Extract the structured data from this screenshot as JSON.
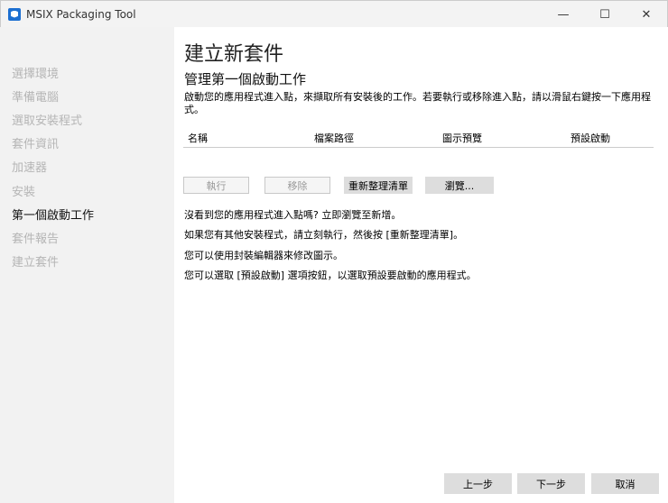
{
  "window": {
    "title": "MSIX Packaging Tool",
    "minimize": "—",
    "maximize": "☐",
    "close": "✕"
  },
  "sidebar": {
    "steps": [
      "選擇環境",
      "準備電腦",
      "選取安裝程式",
      "套件資訊",
      "加速器",
      "安裝",
      "第一個啟動工作",
      "套件報告",
      "建立套件"
    ]
  },
  "main": {
    "title": "建立新套件",
    "subtitle": "管理第一個啟動工作",
    "description": "啟動您的應用程式進入點，來擷取所有安裝後的工作。若要執行或移除進入點，請以滑鼠右鍵按一下應用程式。",
    "columns": [
      "名稱",
      "檔案路徑",
      "圖示預覽",
      "預設啟動"
    ],
    "buttons": {
      "run": "執行",
      "remove": "移除",
      "refresh": "重新整理清單",
      "browse": "瀏覽..."
    },
    "info": [
      "沒看到您的應用程式進入點嗎? 立即瀏覽至新增。",
      "如果您有其他安裝程式，請立刻執行，然後按 [重新整理清單]。",
      "您可以使用封裝編輯器來修改圖示。",
      "您可以選取 [預設啟動] 選項按鈕，以選取預設要啟動的應用程式。"
    ]
  },
  "footer": {
    "back": "上一步",
    "next": "下一步",
    "cancel": "取消"
  }
}
